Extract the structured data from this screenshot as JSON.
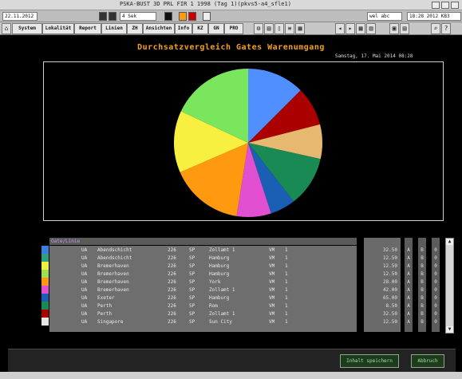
{
  "window": {
    "title": "PSKA-BUST 3D PRL FIR 1 1998 (Tag 1)(pkvs5-a4_sfle1)"
  },
  "statusrow": {
    "left_field": "22.11.2012",
    "mid_field": "4 Sek",
    "user": "wel abc",
    "datetime": "18:28 2012 KB3"
  },
  "toolbar": {
    "buttons": [
      "System",
      "Lokalität",
      "Report",
      "Linien",
      "ZH",
      "Ansichten",
      "Info",
      "KZ",
      "GN",
      "PRO"
    ],
    "icons": [
      "gear-icon",
      "book-icon",
      "document-icon",
      "list-icon",
      "grid-icon",
      "left-arrow-icon",
      "right-arrow-icon",
      "table-icon",
      "chart-icon",
      "print-icon",
      "zoom-icon",
      "help-icon"
    ]
  },
  "chart": {
    "title": "Durchsatzvergleich Gates Warenumgang",
    "date": "Samstag, 17. Mai 2014 08:28"
  },
  "chart_data": {
    "type": "pie",
    "title": "Durchsatzvergleich Gates Warenumgang",
    "slices": [
      {
        "value": 12.5,
        "color": "#4f8fff"
      },
      {
        "value": 8.5,
        "color": "#aa0000"
      },
      {
        "value": 7.5,
        "color": "#e6b870"
      },
      {
        "value": 11,
        "color": "#1a8a55"
      },
      {
        "value": 5.5,
        "color": "#1b5fb5"
      },
      {
        "value": 7.5,
        "color": "#e050d0"
      },
      {
        "value": 16,
        "color": "#ff9a10"
      },
      {
        "value": 13.5,
        "color": "#f7f040"
      },
      {
        "value": 18,
        "color": "#7ae65e"
      }
    ]
  },
  "table": {
    "header": "Gate/Linie",
    "rows": [
      {
        "c1": "UA",
        "c2": "Abendschicht",
        "c3": "226",
        "c4": "SP",
        "c5": "Zollamt 1",
        "c6": "VM",
        "c7": "1",
        "value": "32.50",
        "m1": "A",
        "m2": "B",
        "m3": "0",
        "stripe": "#3a7fe0"
      },
      {
        "c1": "UA",
        "c2": "Abendschicht",
        "c3": "226",
        "c4": "SP",
        "c5": "Hamburg",
        "c6": "VM",
        "c7": "1",
        "value": "12.50",
        "m1": "A",
        "m2": "B",
        "m3": "0",
        "stripe": "#2aa080"
      },
      {
        "c1": "UA",
        "c2": "Bremerhaven",
        "c3": "226",
        "c4": "SP",
        "c5": "Hamburg",
        "c6": "VM",
        "c7": "1",
        "value": "12.50",
        "m1": "A",
        "m2": "B",
        "m3": "0",
        "stripe": "#f0f040"
      },
      {
        "c1": "UA",
        "c2": "Bremerhaven",
        "c3": "226",
        "c4": "SP",
        "c5": "Hamburg",
        "c6": "VM",
        "c7": "1",
        "value": "12.50",
        "m1": "A",
        "m2": "B",
        "m3": "0",
        "stripe": "#a0e050"
      },
      {
        "c1": "UA",
        "c2": "Bremerhaven",
        "c3": "226",
        "c4": "SP",
        "c5": "York",
        "c6": "VM",
        "c7": "1",
        "value": "28.00",
        "m1": "A",
        "m2": "B",
        "m3": "0",
        "stripe": "#ff9a10"
      },
      {
        "c1": "UA",
        "c2": "Bremerhaven",
        "c3": "226",
        "c4": "SP",
        "c5": "Zollamt 1",
        "c6": "VM",
        "c7": "1",
        "value": "42.00",
        "m1": "A",
        "m2": "B",
        "m3": "0",
        "stripe": "#e050d0"
      },
      {
        "c1": "UA",
        "c2": "Exeter",
        "c3": "226",
        "c4": "SP",
        "c5": "Hamburg",
        "c6": "VM",
        "c7": "1",
        "value": "65.00",
        "m1": "A",
        "m2": "B",
        "m3": "0",
        "stripe": "#1b5fb5"
      },
      {
        "c1": "UA",
        "c2": "Perth",
        "c3": "226",
        "c4": "SP",
        "c5": "Rom",
        "c6": "VM",
        "c7": "1",
        "value": "8.50",
        "m1": "A",
        "m2": "B",
        "m3": "0",
        "stripe": "#1a8a55"
      },
      {
        "c1": "UA",
        "c2": "Perth",
        "c3": "226",
        "c4": "SP",
        "c5": "Zollamt 1",
        "c6": "VM",
        "c7": "1",
        "value": "32.50",
        "m1": "A",
        "m2": "B",
        "m3": "0",
        "stripe": "#aa0000"
      },
      {
        "c1": "UA",
        "c2": "Singapore",
        "c3": "226",
        "c4": "SP",
        "c5": "Sun City",
        "c6": "VM",
        "c7": "1",
        "value": "12.50",
        "m1": "A",
        "m2": "B",
        "m3": "0",
        "stripe": "#e6e6e6"
      }
    ]
  },
  "buttons": {
    "export": "Inhalt speichern",
    "close": "Abbruch"
  }
}
